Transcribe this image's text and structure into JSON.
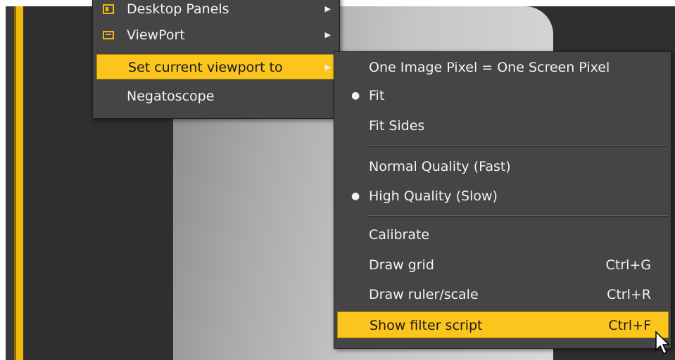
{
  "menu_main": {
    "items": [
      {
        "label": "Desktop Panels",
        "icon": "panel-icon",
        "has_submenu": true
      },
      {
        "label": "ViewPort",
        "icon": "viewport-icon",
        "has_submenu": true
      },
      {
        "label": "Set current viewport to",
        "has_submenu": true,
        "highlighted": true
      },
      {
        "label": "Negatoscope",
        "has_submenu": false
      }
    ]
  },
  "submenu_viewport": {
    "items": [
      {
        "label": "One Image Pixel = One Screen Pixel"
      },
      {
        "label": "Fit",
        "checked": true
      },
      {
        "label": "Fit Sides"
      },
      {
        "label": "Normal Quality (Fast)"
      },
      {
        "label": "High Quality (Slow)",
        "checked": true
      },
      {
        "label": "Calibrate"
      },
      {
        "label": "Draw grid",
        "shortcut": "Ctrl+G"
      },
      {
        "label": "Draw ruler/scale",
        "shortcut": "Ctrl+R"
      },
      {
        "label": "Show filter script",
        "shortcut": "Ctrl+F",
        "highlighted": true
      }
    ]
  },
  "colors": {
    "accent": "#fcc51d",
    "sidebar_accent": "#f0b90b",
    "menu_bg": "#454545",
    "menu_text": "#f2f2f2"
  },
  "glyphs": {
    "submenu_arrow": "▶",
    "check_bullet": "●"
  }
}
